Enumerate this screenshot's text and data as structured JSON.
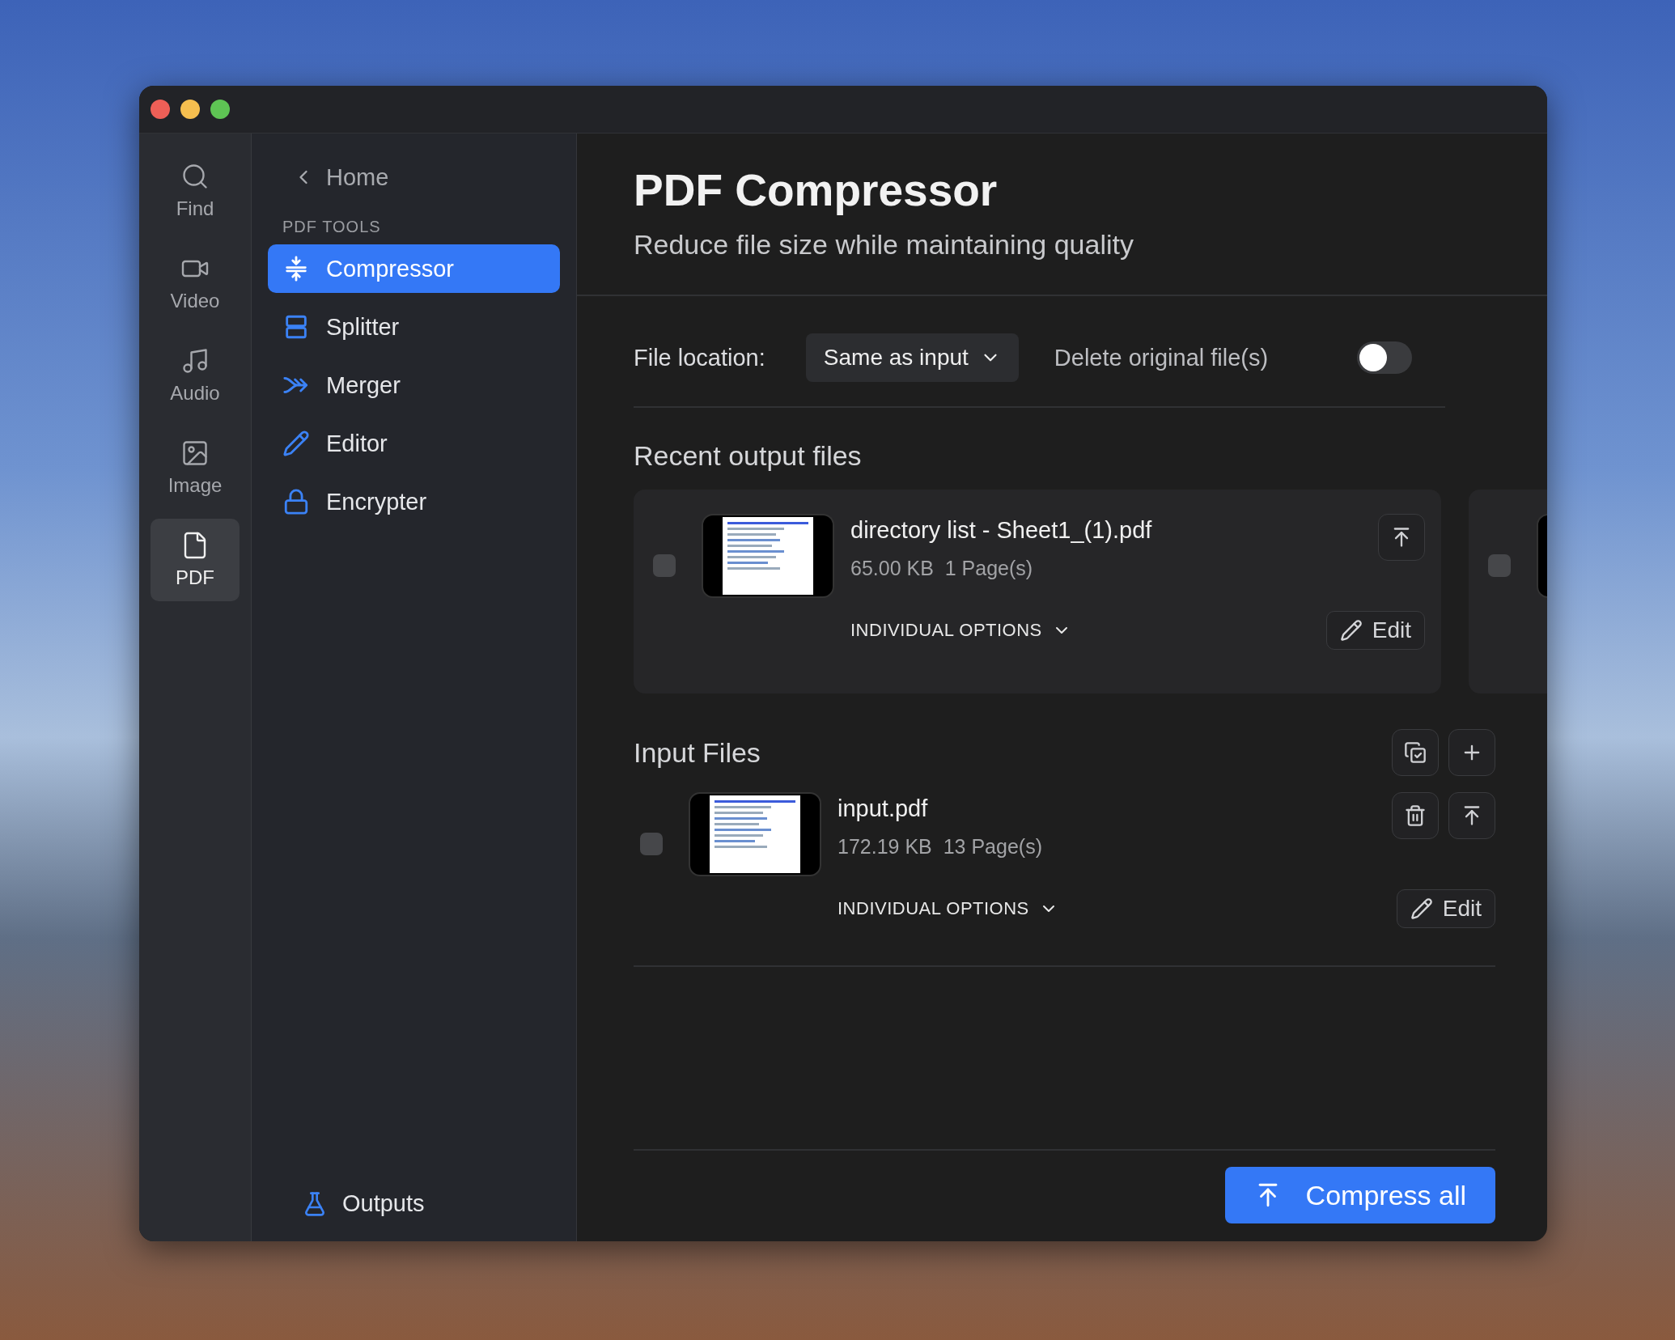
{
  "rail": {
    "items": [
      {
        "label": "Find",
        "selected": false
      },
      {
        "label": "Video",
        "selected": false
      },
      {
        "label": "Audio",
        "selected": false
      },
      {
        "label": "Image",
        "selected": false
      },
      {
        "label": "PDF",
        "selected": true
      }
    ]
  },
  "sidebar": {
    "back": "Home",
    "section": "PDF TOOLS",
    "items": [
      {
        "label": "Compressor",
        "selected": true
      },
      {
        "label": "Splitter",
        "selected": false
      },
      {
        "label": "Merger",
        "selected": false
      },
      {
        "label": "Editor",
        "selected": false
      },
      {
        "label": "Encrypter",
        "selected": false
      }
    ],
    "footer": "Outputs"
  },
  "main": {
    "title": "PDF Compressor",
    "subtitle": "Reduce file size while maintaining quality",
    "settings": {
      "location_label": "File location:",
      "location_value": "Same as input",
      "delete_label": "Delete original file(s)",
      "delete_on": false
    },
    "recent": {
      "heading": "Recent output files",
      "files": [
        {
          "name": "directory list - Sheet1_(1).pdf",
          "size": "65.00 KB",
          "pages": "1 Page(s)",
          "checked": false,
          "options": "INDIVIDUAL OPTIONS",
          "edit": "Edit"
        },
        {
          "checked": false
        }
      ]
    },
    "input": {
      "heading": "Input Files",
      "files": [
        {
          "name": "input.pdf",
          "size": "172.19 KB",
          "pages": "13 Page(s)",
          "checked": false,
          "options": "INDIVIDUAL OPTIONS",
          "edit": "Edit"
        }
      ]
    },
    "action": "Compress all"
  }
}
